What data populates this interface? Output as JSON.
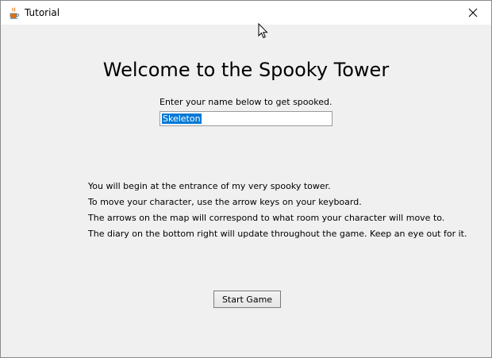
{
  "window": {
    "title": "Tutorial",
    "app_icon": "java-cup-icon",
    "close_icon": "close-icon"
  },
  "main": {
    "heading": "Welcome to the Spooky Tower",
    "prompt": "Enter your name below to get spooked.",
    "name_input": {
      "value": "Skeleton",
      "selected": true
    },
    "instructions": [
      "You will begin at the entrance of my very spooky tower.",
      "To move your character, use the arrow keys on your keyboard.",
      "The arrows on the map will correspond to what room your character will move to.",
      "The diary on the bottom right will update throughout the game. Keep an eye out for it."
    ],
    "start_button_label": "Start Game"
  },
  "colors": {
    "content_bg": "#f0f0f0",
    "selection": "#0078d7",
    "titlebar_bg": "#ffffff"
  }
}
